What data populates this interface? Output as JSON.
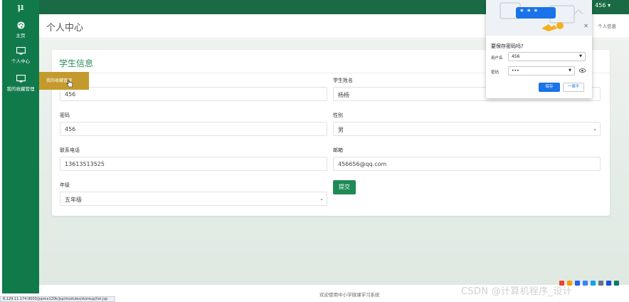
{
  "app": {
    "logo_text": "μ",
    "user": "456 ▾"
  },
  "sidebar": {
    "items": [
      {
        "label": "主页",
        "icon": "palette-icon"
      },
      {
        "label": "个人中心",
        "icon": "monitor-icon"
      },
      {
        "label": "我的收藏管理",
        "icon": "monitor-icon"
      }
    ],
    "flyout_label": "我的收藏管理"
  },
  "header": {
    "page_title": "个人中心",
    "breadcrumb_right": "个人信息"
  },
  "form": {
    "title": "学生信息",
    "labels": {
      "student_name": "学生姓名",
      "password": "密码",
      "gender": "性别",
      "phone": "联系电话",
      "email": "邮箱",
      "grade": "年级"
    },
    "values": {
      "student_id": "456",
      "student_name": "杨杨",
      "password": "456",
      "gender": "男",
      "phone": "13613513525",
      "email": "456656@qq.com",
      "grade": "五年级"
    },
    "submit_label": "提交"
  },
  "footer": {
    "text": "欢迎使用中小学微课学习系统"
  },
  "status_bar": {
    "url": "8.129.11.174:9003/jspmx120k/jsp/modules/storeup/list.jsp"
  },
  "watermark": "CSDN @计算机程序_设计",
  "password_popup": {
    "title": "要保存密码吗?",
    "username_label": "用户名",
    "username_value": "456",
    "password_label": "密码",
    "password_value": "•••",
    "art_text": "* * *",
    "save_label": "保存",
    "never_label": "一律不",
    "accent": "#1a73e8"
  }
}
